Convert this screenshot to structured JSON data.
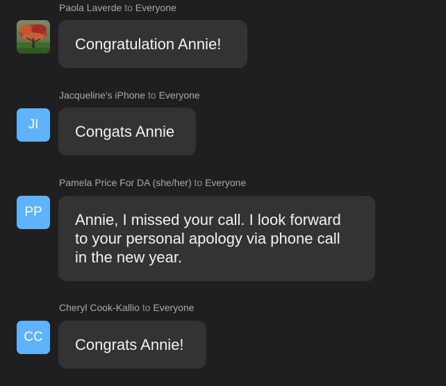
{
  "messages": [
    {
      "sender": "Paola Laverde",
      "recipient_prefix": "to",
      "recipient": "Everyone",
      "avatar_initials": "",
      "avatar_icon": "tree-photo-icon",
      "text": "Congratulation Annie!"
    },
    {
      "sender": "Jacqueline's iPhone",
      "recipient_prefix": "to",
      "recipient": "Everyone",
      "avatar_initials": "JI",
      "text": "Congats Annie"
    },
    {
      "sender": "Pamela Price For DA (she/her)",
      "recipient_prefix": "to",
      "recipient": "Everyone",
      "avatar_initials": "PP",
      "text_lines": [
        "Annie, I missed your call. I look forward",
        "to your personal apology via phone call",
        "in the new year."
      ]
    },
    {
      "sender": "Cheryl Cook-Kallio",
      "recipient_prefix": "to",
      "recipient": "Everyone",
      "avatar_initials": "CC",
      "text": "Congrats Annie!"
    }
  ],
  "colors": {
    "background": "#1f1f21",
    "bubble": "#333336",
    "avatar_blue": "#5fb3fa",
    "meta_text": "#a9a9ad"
  }
}
